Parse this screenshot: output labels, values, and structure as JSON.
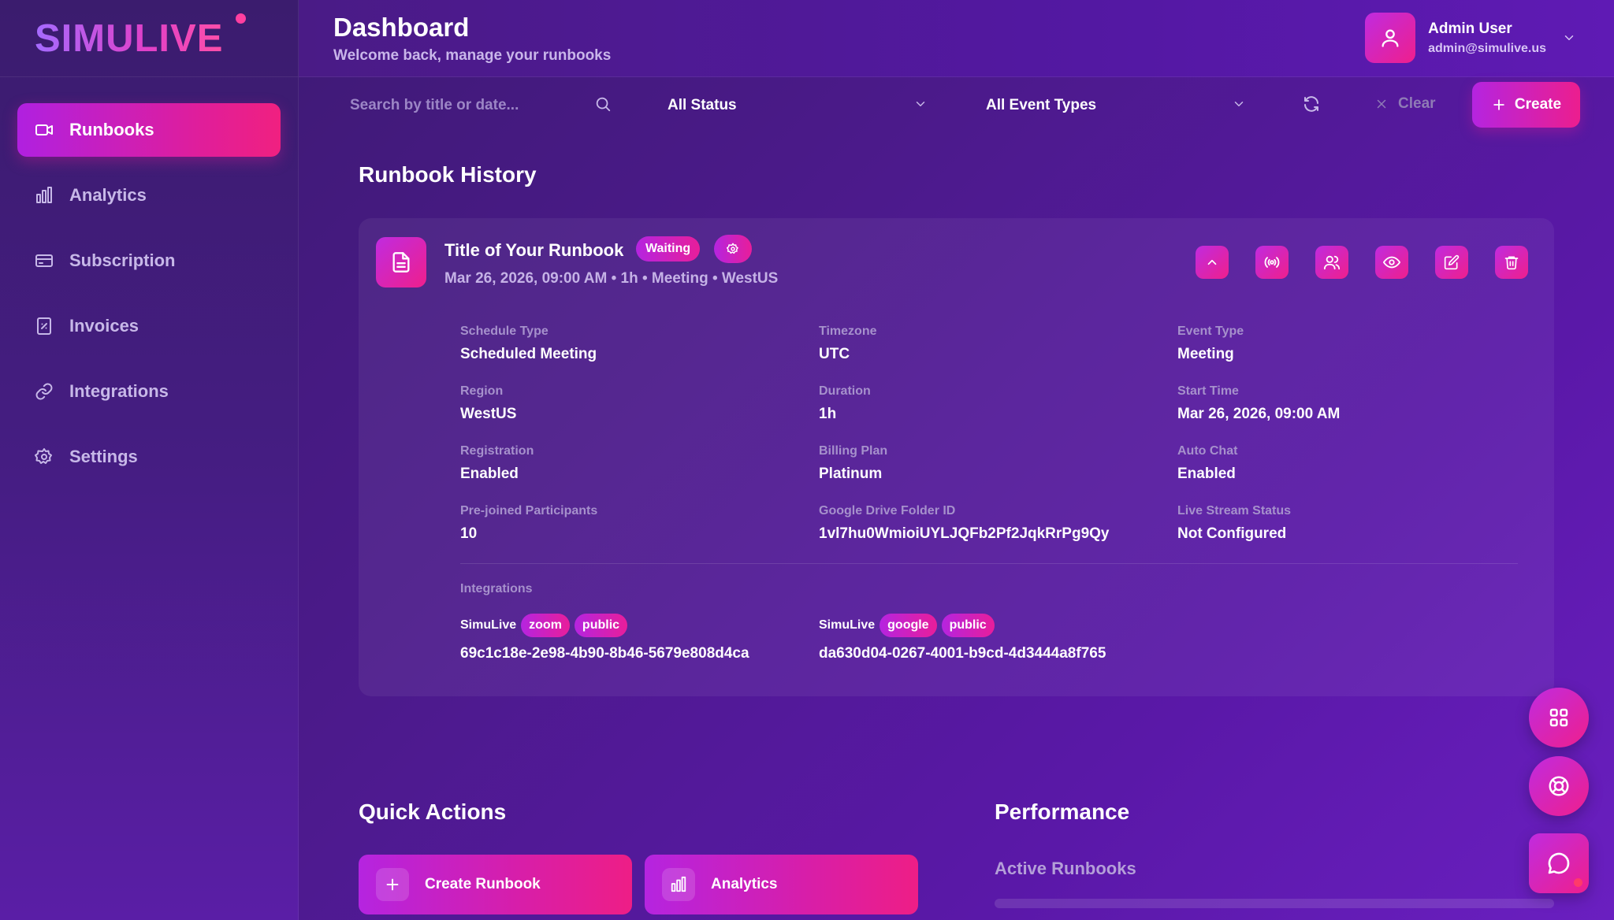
{
  "brand": {
    "logo_text": "SIMULIVE"
  },
  "sidebar": {
    "items": [
      {
        "label": "Runbooks",
        "icon": "video-icon",
        "active": true
      },
      {
        "label": "Analytics",
        "icon": "bar-chart-icon"
      },
      {
        "label": "Subscription",
        "icon": "credit-card-icon"
      },
      {
        "label": "Invoices",
        "icon": "receipt-icon"
      },
      {
        "label": "Integrations",
        "icon": "link-icon"
      },
      {
        "label": "Settings",
        "icon": "gear-icon"
      }
    ]
  },
  "header": {
    "title": "Dashboard",
    "subtitle": "Welcome back, manage your runbooks",
    "user": {
      "name": "Admin User",
      "email": "admin@simulive.us"
    }
  },
  "toolbar": {
    "search_placeholder": "Search by title or date...",
    "status_filter": "All Status",
    "event_type_filter": "All Event Types",
    "clear_label": "Clear",
    "create_label": "Create"
  },
  "history": {
    "title": "Runbook History",
    "runbook": {
      "title": "Title of Your Runbook",
      "status": "Waiting",
      "meta": "Mar 26, 2026, 09:00 AM • 1h • Meeting • WestUS",
      "fields": [
        {
          "label": "Schedule Type",
          "value": "Scheduled Meeting"
        },
        {
          "label": "Timezone",
          "value": "UTC"
        },
        {
          "label": "Event Type",
          "value": "Meeting"
        },
        {
          "label": "Region",
          "value": "WestUS"
        },
        {
          "label": "Duration",
          "value": "1h"
        },
        {
          "label": "Start Time",
          "value": "Mar 26, 2026, 09:00 AM"
        },
        {
          "label": "Registration",
          "value": "Enabled"
        },
        {
          "label": "Billing Plan",
          "value": "Platinum"
        },
        {
          "label": "Auto Chat",
          "value": "Enabled"
        },
        {
          "label": "Pre-joined Participants",
          "value": "10"
        },
        {
          "label": "Google Drive Folder ID",
          "value": "1vl7hu0WmioiUYLJQFb2Pf2JqkRrPg9Qy"
        },
        {
          "label": "Live Stream Status",
          "value": "Not Configured"
        }
      ],
      "integrations_label": "Integrations",
      "integrations": [
        {
          "name": "SimuLive",
          "tags": [
            "zoom",
            "public"
          ],
          "id": "69c1c18e-2e98-4b90-8b46-5679e808d4ca"
        },
        {
          "name": "SimuLive",
          "tags": [
            "google",
            "public"
          ],
          "id": "da630d04-0267-4001-b9cd-4d3444a8f765"
        }
      ]
    }
  },
  "quick_actions": {
    "title": "Quick Actions",
    "buttons": [
      {
        "label": "Create Runbook",
        "icon": "plus-icon"
      },
      {
        "label": "Analytics",
        "icon": "bar-chart-icon"
      }
    ]
  },
  "performance": {
    "title": "Performance",
    "subtitle": "Active Runbooks"
  },
  "colors": {
    "accent_start": "#b524e0",
    "accent_end": "#ec1e8e",
    "background": "#4b1a8a"
  }
}
